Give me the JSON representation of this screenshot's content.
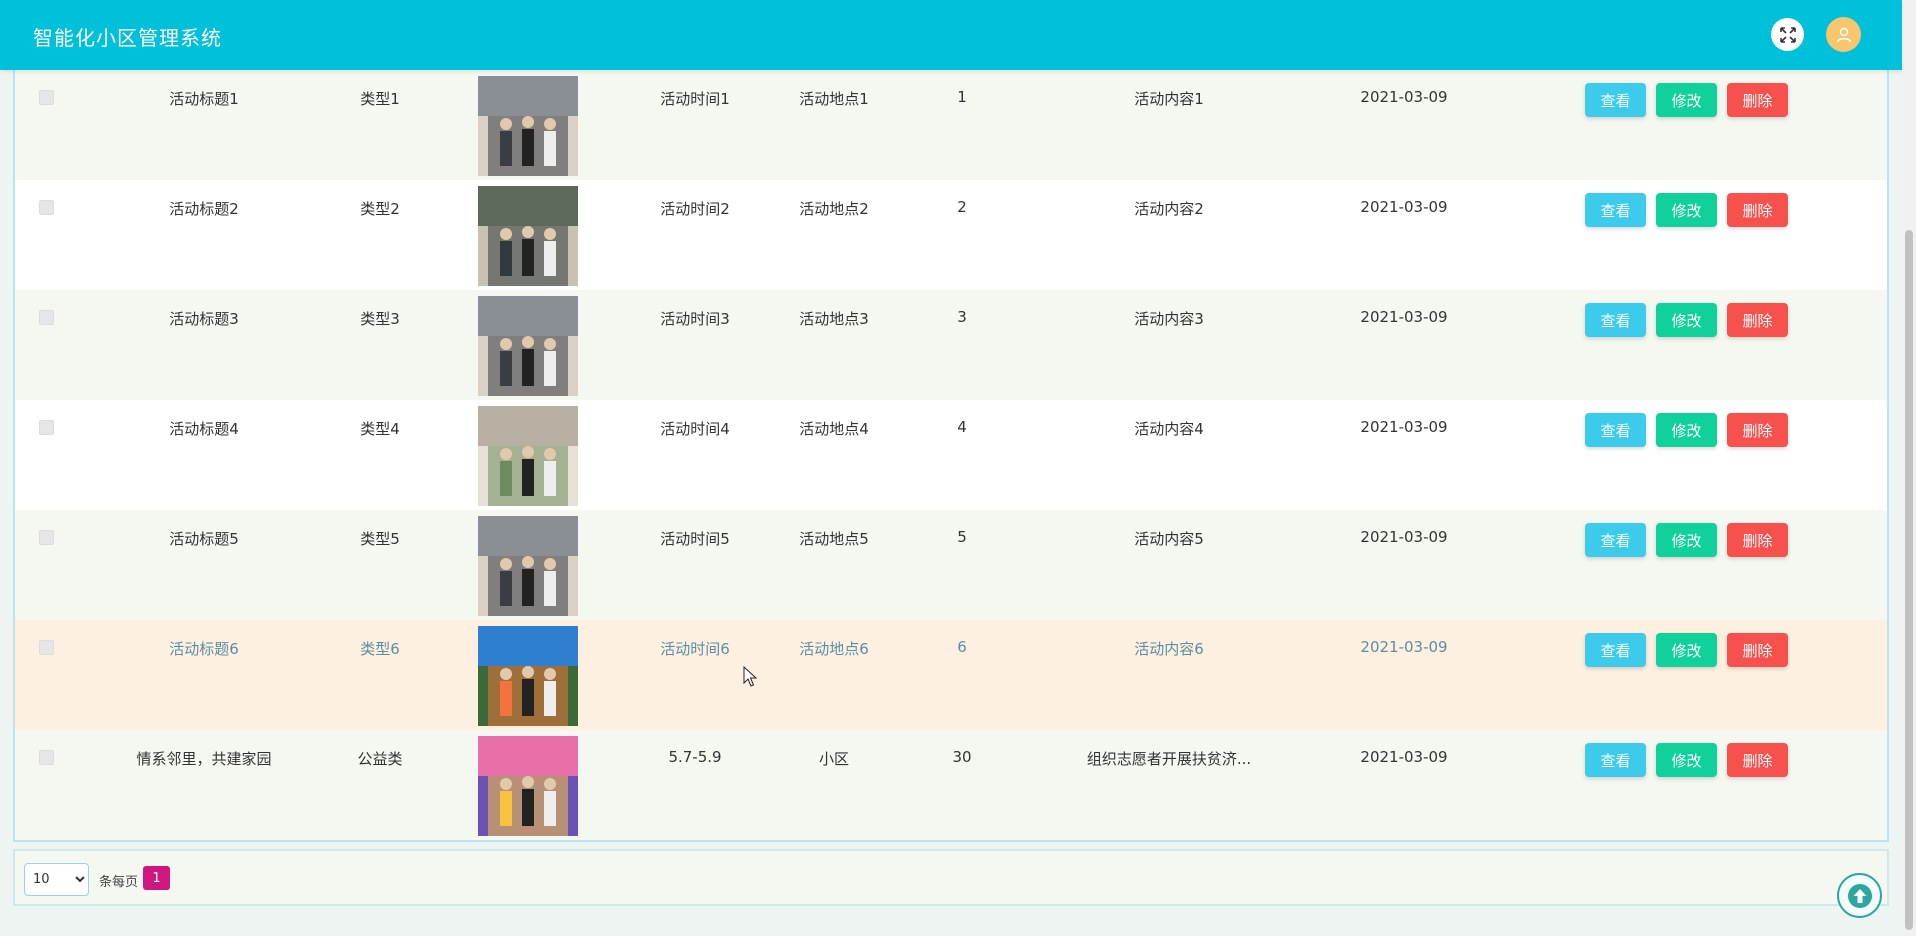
{
  "header": {
    "title": "智能化小区管理系统"
  },
  "actions": {
    "view": "查看",
    "edit": "修改",
    "delete": "删除"
  },
  "rows": [
    {
      "title": "活动标题1",
      "type": "类型1",
      "time": "活动时间1",
      "place": "活动地点1",
      "count": "1",
      "content": "活动内容1",
      "date": "2021-03-09"
    },
    {
      "title": "活动标题2",
      "type": "类型2",
      "time": "活动时间2",
      "place": "活动地点2",
      "count": "2",
      "content": "活动内容2",
      "date": "2021-03-09"
    },
    {
      "title": "活动标题3",
      "type": "类型3",
      "time": "活动时间3",
      "place": "活动地点3",
      "count": "3",
      "content": "活动内容3",
      "date": "2021-03-09"
    },
    {
      "title": "活动标题4",
      "type": "类型4",
      "time": "活动时间4",
      "place": "活动地点4",
      "count": "4",
      "content": "活动内容4",
      "date": "2021-03-09"
    },
    {
      "title": "活动标题5",
      "type": "类型5",
      "time": "活动时间5",
      "place": "活动地点5",
      "count": "5",
      "content": "活动内容5",
      "date": "2021-03-09"
    },
    {
      "title": "活动标题6",
      "type": "类型6",
      "time": "活动时间6",
      "place": "活动地点6",
      "count": "6",
      "content": "活动内容6",
      "date": "2021-03-09"
    },
    {
      "title": "情系邻里，共建家园",
      "type": "公益类",
      "time": "5.7-5.9",
      "place": "小区",
      "count": "30",
      "content": "组织志愿者开展扶贫济...",
      "date": "2021-03-09"
    }
  ],
  "pagination": {
    "page_size": "10",
    "per_page_label": "条每页",
    "current_page": "1"
  },
  "icons": {
    "fullscreen": "fullscreen-icon",
    "user": "user-icon",
    "back_to_top": "arrow-up-icon"
  },
  "colors": {
    "header": "#00c0da",
    "view": "#3ccbea",
    "edit": "#11d19a",
    "delete": "#f7514e",
    "page_active": "#d0177f"
  }
}
